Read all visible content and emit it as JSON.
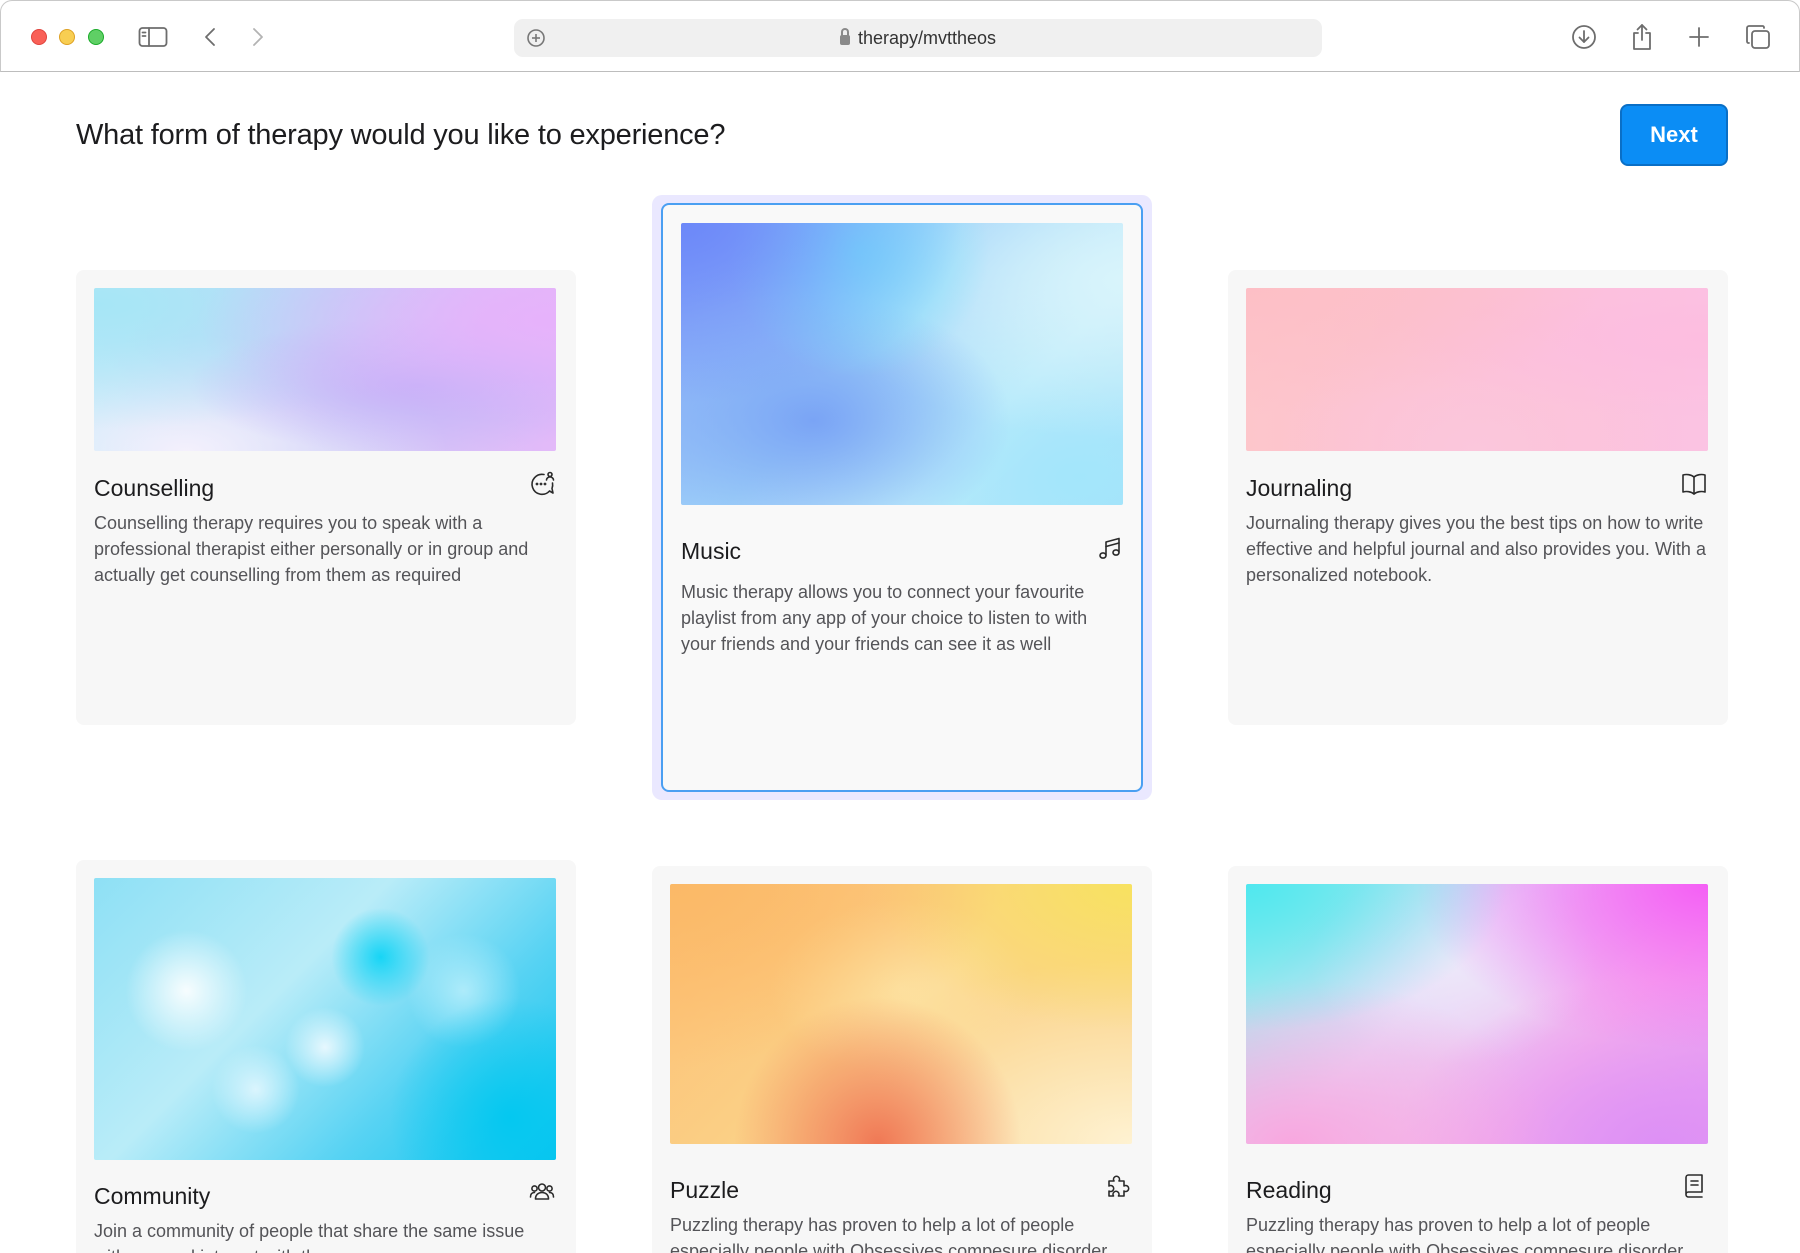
{
  "browser": {
    "url": "therapy/mvttheos",
    "icons": [
      "sidebar-icon",
      "back-icon",
      "forward-icon",
      "add-icon",
      "download-icon",
      "share-icon",
      "new-tab-icon",
      "tabs-overview-icon"
    ]
  },
  "page": {
    "title": "What form of therapy would you like to experience?",
    "next_label": "Next"
  },
  "colors": {
    "accent": "#0b8df5",
    "selected_border": "#4a9ff2",
    "selected_halo": "#eae8ff",
    "card_bg": "#f7f7f7"
  },
  "cards": [
    {
      "title": "Counselling",
      "icon": "chat-person-icon",
      "description": "Counselling therapy requires you to speak with a professional therapist either personally or in group and actually get counselling from them as required",
      "selected": false
    },
    {
      "title": "Music",
      "icon": "music-note-icon",
      "description": "Music therapy allows you to connect your favourite playlist from any app of your choice to listen to with your friends and your friends can see it as well",
      "selected": true
    },
    {
      "title": "Journaling",
      "icon": "book-open-icon",
      "description": "Journaling therapy gives you the best tips on how to write effective and helpful journal and also provides you. With a personalized notebook.",
      "selected": false
    },
    {
      "title": "Community",
      "icon": "people-icon",
      "description": "Join a community of people that share the same issue with you and interact with them",
      "selected": false
    },
    {
      "title": "Puzzle",
      "icon": "puzzle-piece-icon",
      "description": "Puzzling therapy has proven to help a lot of people especially people with Obsessives compesure disorder",
      "selected": false
    },
    {
      "title": "Reading",
      "icon": "book-icon",
      "description": "Puzzling therapy has proven to help a lot of people especially people with Obsessives compesure disorder",
      "selected": false
    }
  ]
}
